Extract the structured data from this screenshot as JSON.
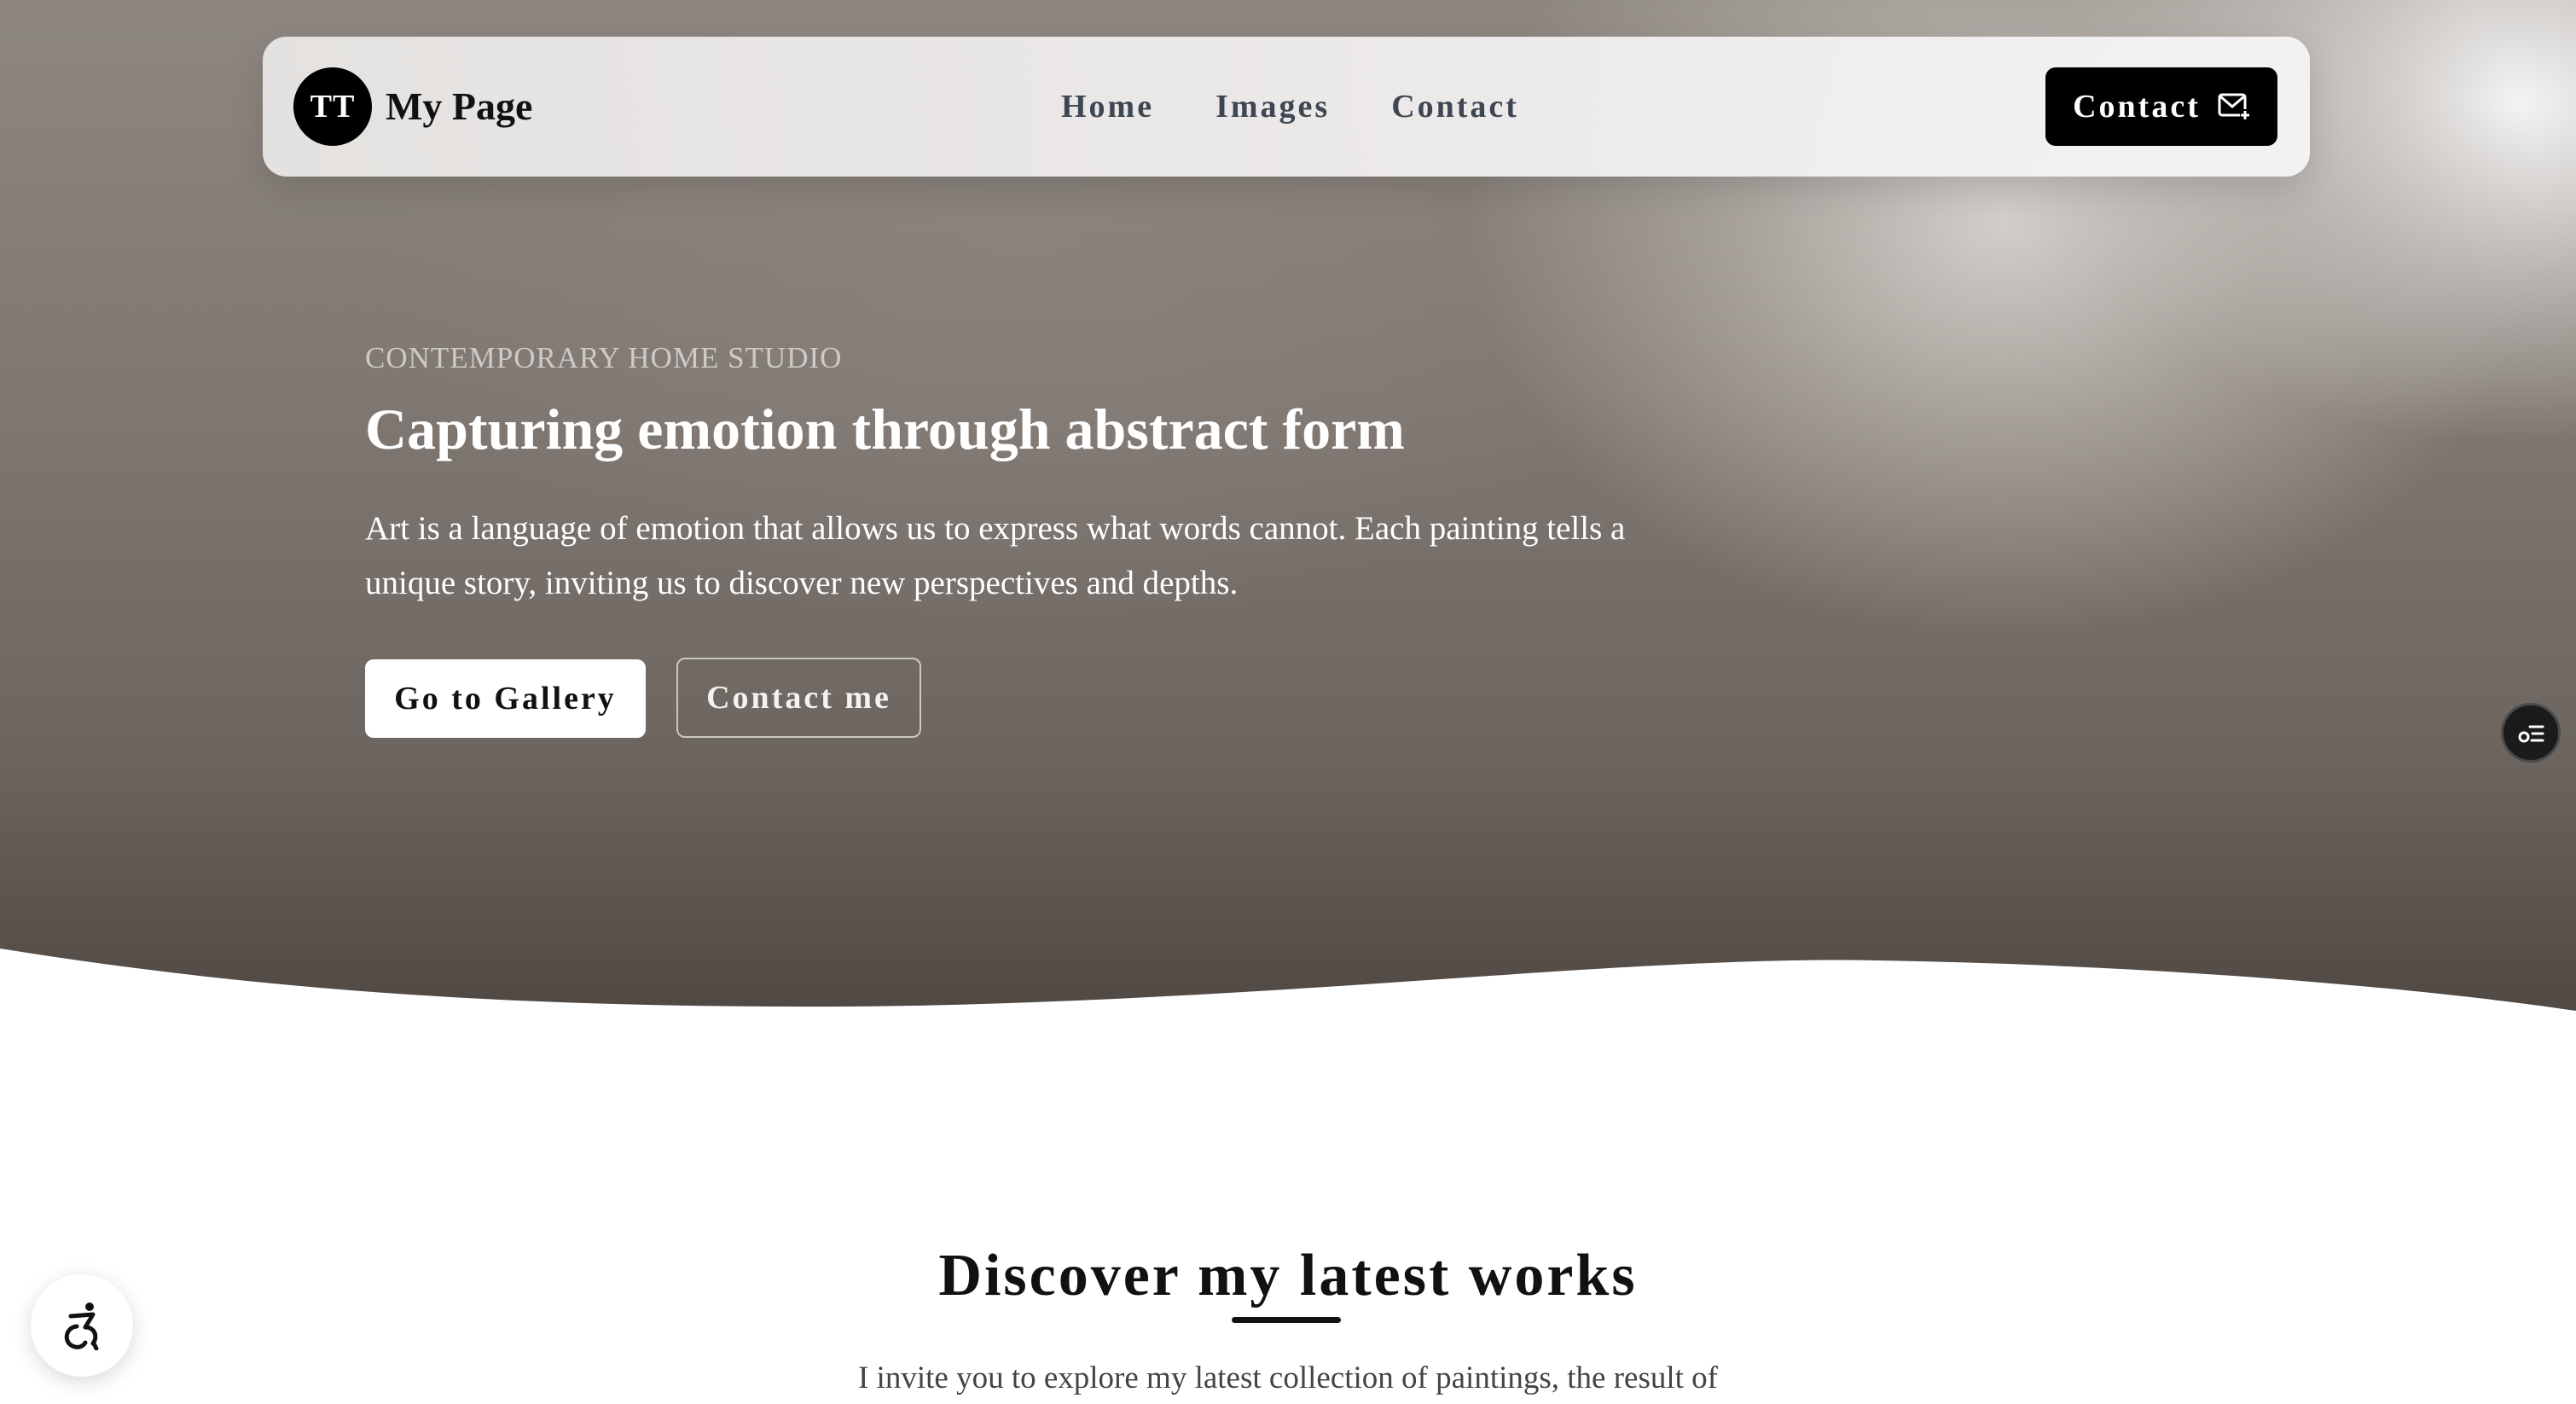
{
  "header": {
    "logo_initials": "TT",
    "site_title": "My Page",
    "nav": [
      {
        "label": "Home"
      },
      {
        "label": "Images"
      },
      {
        "label": "Contact"
      }
    ],
    "cta_label": "Contact"
  },
  "hero": {
    "eyebrow": "CONTEMPORARY HOME STUDIO",
    "headline": "Capturing emotion through abstract form",
    "body": "Art is a language of emotion that allows us to express what words cannot. Each painting tells a unique story, inviting us to discover new perspectives and depths.",
    "primary_button": "Go to Gallery",
    "secondary_button": "Contact me"
  },
  "latest": {
    "title": "Discover my latest works",
    "intro": "I invite you to explore my latest collection of paintings, the result of"
  },
  "icons": {
    "cta_icon": "mail-plus-icon",
    "side_fab_icon": "list-settings-icon",
    "accessibility_icon": "accessibility-icon"
  },
  "colors": {
    "hero_top": "#8e8781",
    "hero_bottom": "#4f4843",
    "nav_background": "#eeeceb",
    "primary": "#000000",
    "nav_link": "#3d4652"
  }
}
